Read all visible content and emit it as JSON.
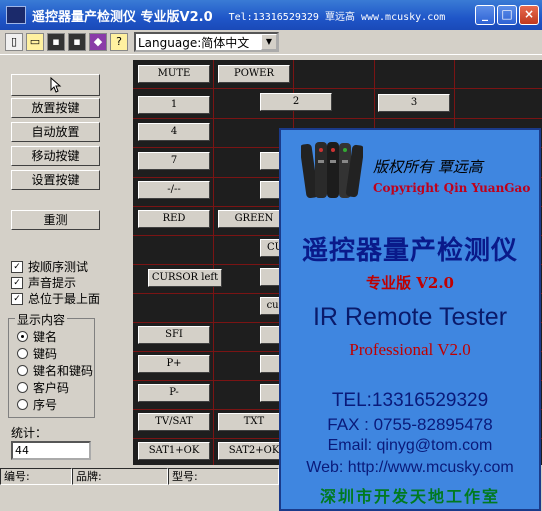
{
  "window": {
    "title": "遥控器量产检测仪 专业版V2.0",
    "contact": "Tel:13316529329 覃远高 www.mcusky.com",
    "buttons": [
      "_",
      "□",
      "×"
    ]
  },
  "toolbar": {
    "icons": [
      "new-file-icon",
      "open-folder-icon",
      "save-icon",
      "save-all-icon",
      "book-icon",
      "help-icon"
    ],
    "language_value": "Language:简体中文"
  },
  "left_panel": {
    "buttons": [
      "",
      "放置按键",
      "自动放置",
      "移动按键",
      "设置按键",
      "重测"
    ],
    "checkboxes": [
      {
        "label": "按顺序测试",
        "checked": true
      },
      {
        "label": "声音提示",
        "checked": true
      },
      {
        "label": "总位于最上面",
        "checked": true
      }
    ],
    "display_group": {
      "title": "显示内容",
      "options": [
        {
          "label": "键名",
          "selected": true
        },
        {
          "label": "键码",
          "selected": false
        },
        {
          "label": "键名和键码",
          "selected": false
        },
        {
          "label": "客户码",
          "selected": false
        },
        {
          "label": "序号",
          "selected": false
        }
      ]
    },
    "count_label": "统计：",
    "count_value": "44"
  },
  "grid_buttons": [
    "MUTE",
    "POWER",
    "1",
    "2",
    "3",
    "4",
    "7",
    "-/--",
    "RED",
    "GREEN",
    "CU",
    "CURSOR left",
    "cur",
    "SFI",
    "P+",
    "P-",
    "TV/SAT",
    "TXT",
    "SAT1+OK",
    "SAT2+OK"
  ],
  "splash": {
    "copyright_cn": "版权所有 覃远高",
    "copyright_en": "Copyright Qin YuanGao",
    "title_cn": "遥控器量产检测仪",
    "edition": "专业版 V2.0",
    "title_en": "IR Remote Tester",
    "professional": "Professional V2.0",
    "tel": "TEL:13316529329",
    "fax": "FAX : 0755-82895478",
    "email": "Email: qinyg@tom.com",
    "web": "Web: http://www.mcusky.com",
    "studio": "深圳市开发天地工作室"
  },
  "statusbar": {
    "cells": [
      "编号:",
      "品牌:",
      "型号:"
    ]
  }
}
